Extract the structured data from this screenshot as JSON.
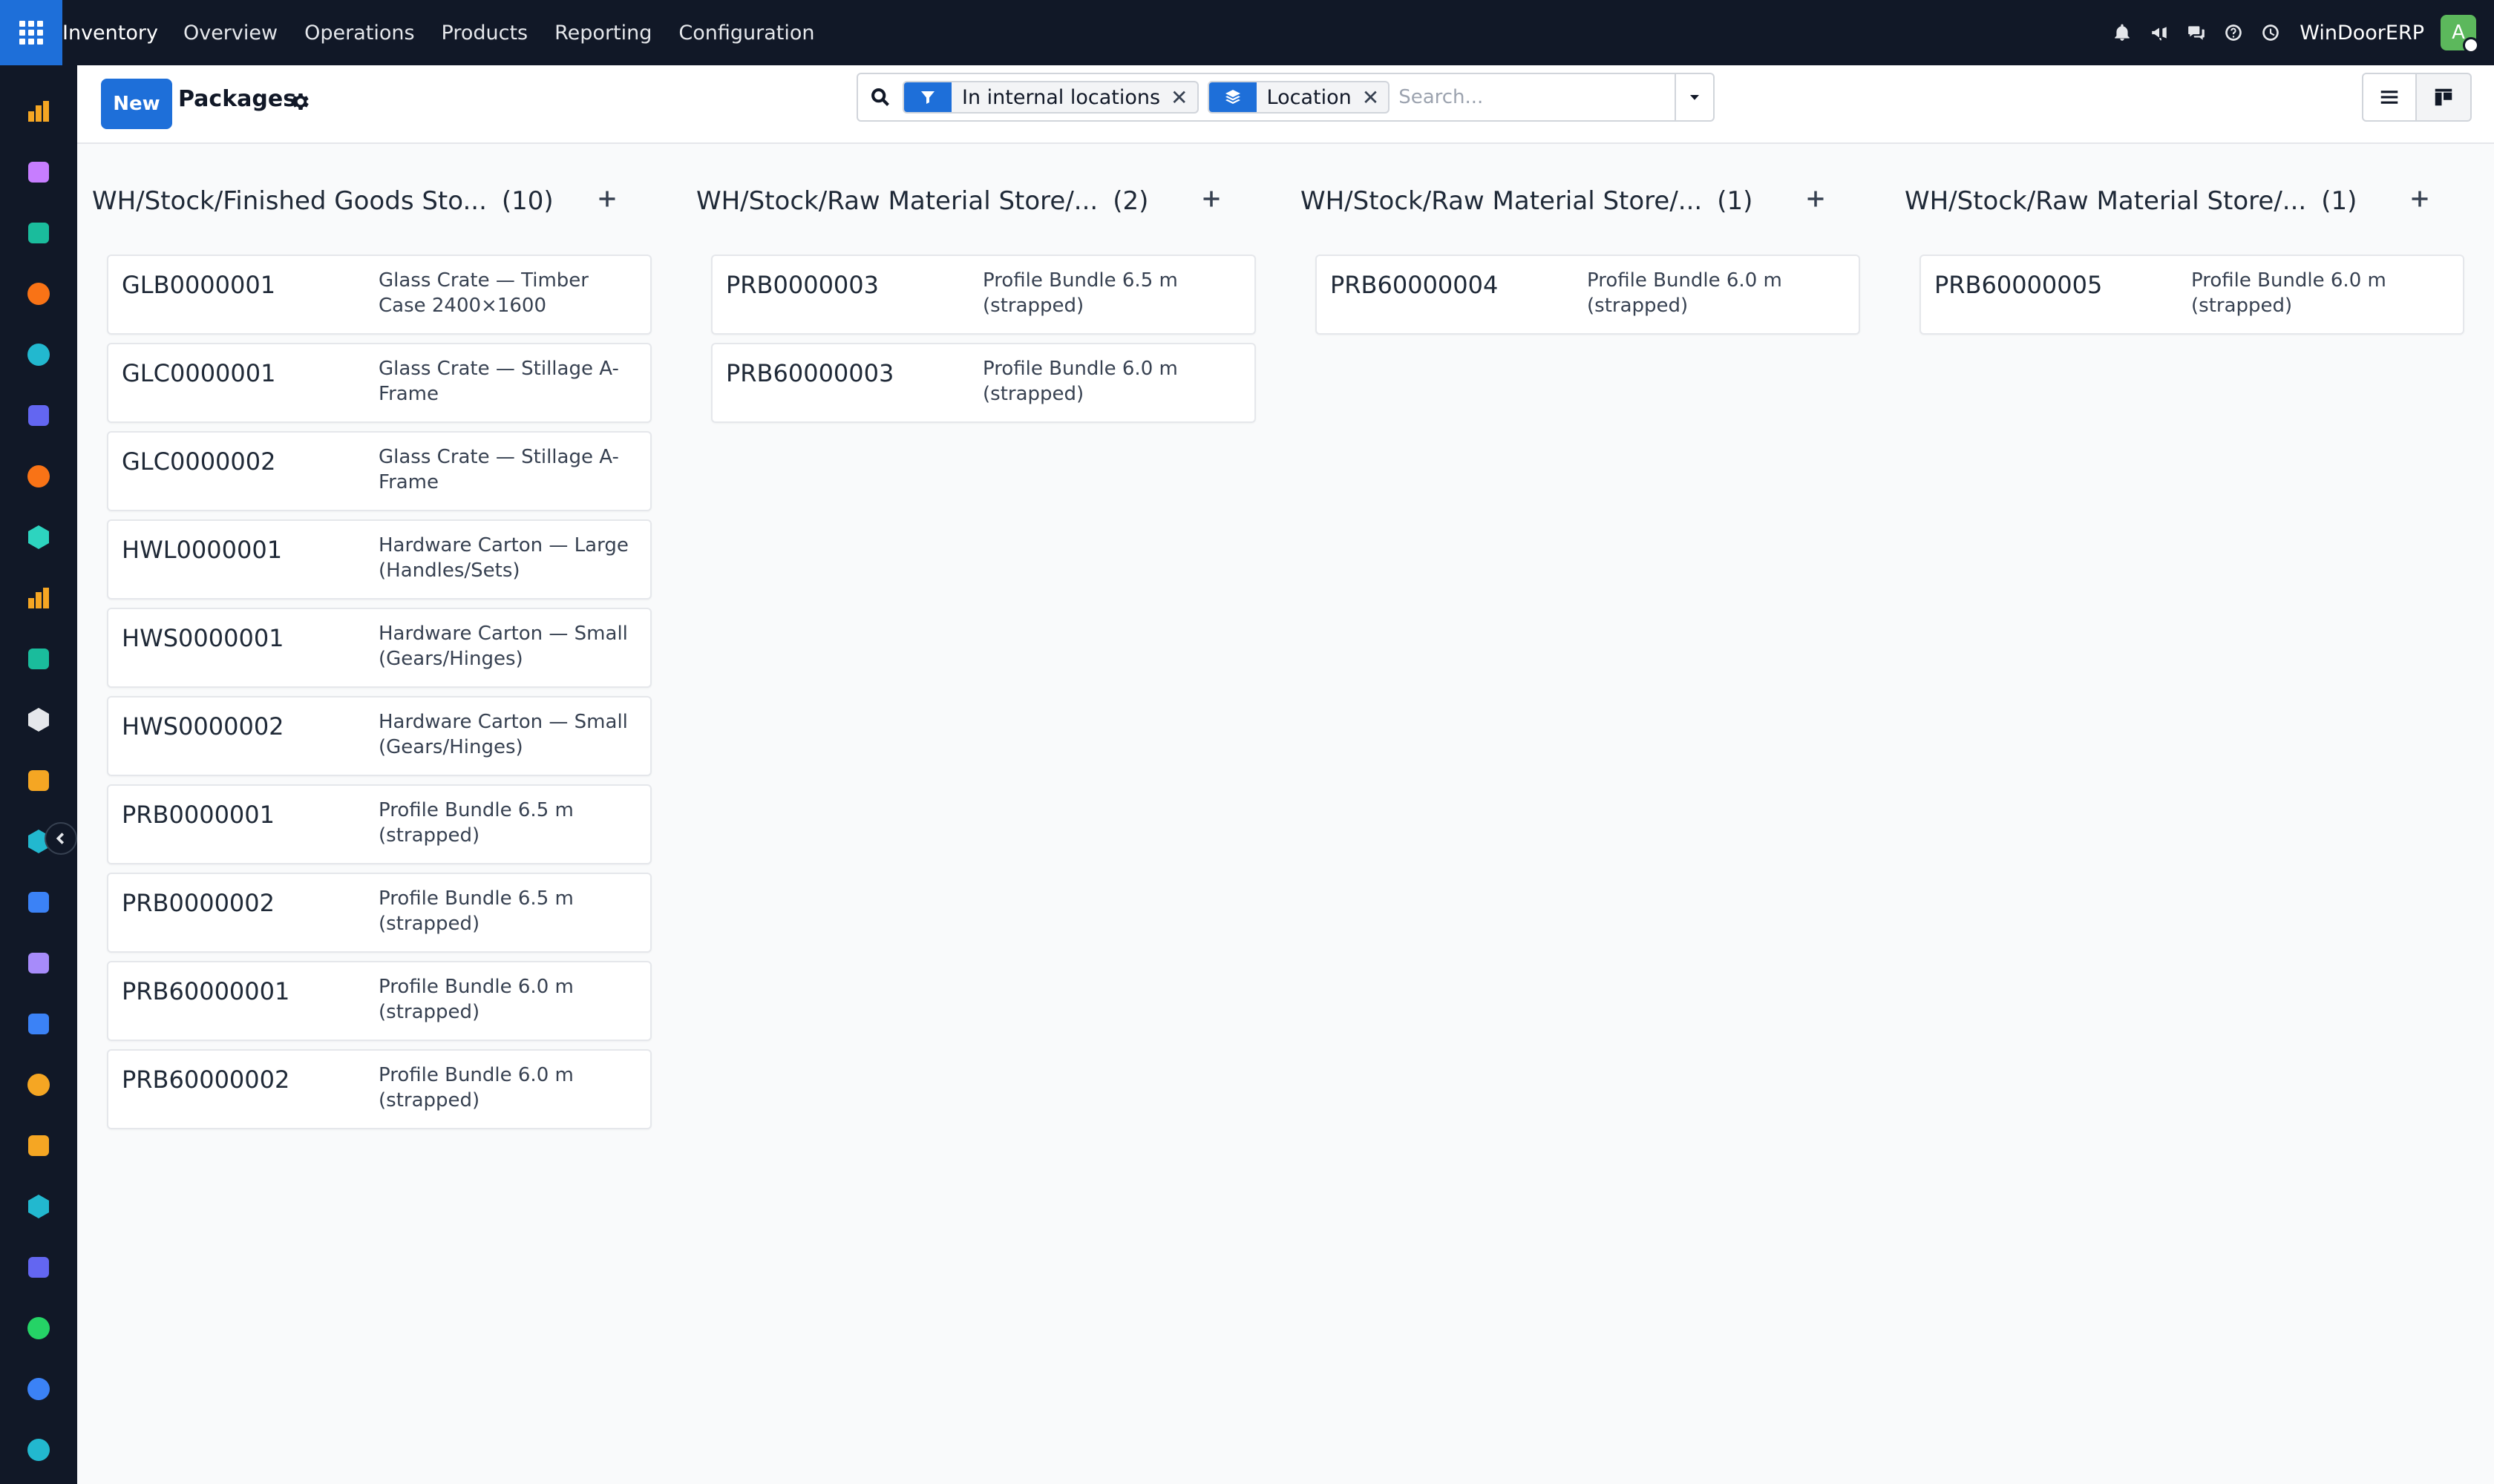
{
  "nav": {
    "brand": "Inventory",
    "menu": [
      "Overview",
      "Operations",
      "Products",
      "Reporting",
      "Configuration"
    ],
    "company": "WinDoorERP",
    "avatar_letter": "A"
  },
  "control": {
    "new_label": "New",
    "title": "Packages"
  },
  "search": {
    "facets": [
      {
        "label": "In internal locations",
        "icon": "filter-icon"
      },
      {
        "label": "Location",
        "icon": "layers-icon"
      }
    ],
    "placeholder": "Search..."
  },
  "columns": [
    {
      "title": "WH/Stock/Finished Goods Sto...",
      "count": "(10)",
      "cards": [
        {
          "name": "GLB0000001",
          "type": "Glass Crate — Timber Case 2400×1600"
        },
        {
          "name": "GLC0000001",
          "type": "Glass Crate — Stillage A-Frame"
        },
        {
          "name": "GLC0000002",
          "type": "Glass Crate — Stillage A-Frame"
        },
        {
          "name": "HWL0000001",
          "type": "Hardware Carton — Large (Handles/Sets)"
        },
        {
          "name": "HWS0000001",
          "type": "Hardware Carton — Small (Gears/Hinges)"
        },
        {
          "name": "HWS0000002",
          "type": "Hardware Carton — Small (Gears/Hinges)"
        },
        {
          "name": "PRB0000001",
          "type": "Profile Bundle 6.5 m (strapped)"
        },
        {
          "name": "PRB0000002",
          "type": "Profile Bundle 6.5 m (strapped)"
        },
        {
          "name": "PRB60000001",
          "type": "Profile Bundle 6.0 m (strapped)"
        },
        {
          "name": "PRB60000002",
          "type": "Profile Bundle 6.0 m (strapped)"
        }
      ]
    },
    {
      "title": "WH/Stock/Raw Material Store/...",
      "count": "(2)",
      "cards": [
        {
          "name": "PRB0000003",
          "type": "Profile Bundle 6.5 m (strapped)"
        },
        {
          "name": "PRB60000003",
          "type": "Profile Bundle 6.0 m (strapped)"
        }
      ]
    },
    {
      "title": "WH/Stock/Raw Material Store/...",
      "count": "(1)",
      "cards": [
        {
          "name": "PRB60000004",
          "type": "Profile Bundle 6.0 m (strapped)"
        }
      ]
    },
    {
      "title": "WH/Stock/Raw Material Store/...",
      "count": "(1)",
      "cards": [
        {
          "name": "PRB60000005",
          "type": "Profile Bundle 6.0 m (strapped)"
        }
      ]
    }
  ],
  "rail_apps": [
    {
      "icon": "dashboard-icon",
      "color": "#f5a623"
    },
    {
      "icon": "studio-icon",
      "color": "#c77dff"
    },
    {
      "icon": "contacts-icon",
      "color": "#1abc9c"
    },
    {
      "icon": "chat-icon",
      "color": "#f97316"
    },
    {
      "icon": "website-icon",
      "color": "#22b8cf"
    },
    {
      "icon": "mail-icon",
      "color": "#6366f1"
    },
    {
      "icon": "discuss-icon",
      "color": "#f97316"
    },
    {
      "icon": "crm-icon",
      "color": "#2dd4bf"
    },
    {
      "icon": "sales-icon",
      "color": "#f5a623"
    },
    {
      "icon": "employees-icon",
      "color": "#1abc9c"
    },
    {
      "icon": "inventory-icon",
      "color": "#e5e7eb"
    },
    {
      "icon": "spreadsheet-icon",
      "color": "#f5a623"
    },
    {
      "icon": "todo-icon",
      "color": "#22b8cf"
    },
    {
      "icon": "knowledge-icon",
      "color": "#3b82f6"
    },
    {
      "icon": "purchase-icon",
      "color": "#a78bfa"
    },
    {
      "icon": "invoicing-icon",
      "color": "#3b82f6"
    },
    {
      "icon": "team-icon",
      "color": "#f5a623"
    },
    {
      "icon": "calendar-icon",
      "color": "#f5a623"
    },
    {
      "icon": "sign-icon",
      "color": "#22b8cf"
    },
    {
      "icon": "apps-dashboard-icon",
      "color": "#6366f1"
    },
    {
      "icon": "whatsapp-icon",
      "color": "#25d366"
    },
    {
      "icon": "timer-icon",
      "color": "#3b82f6"
    },
    {
      "icon": "website-builder-icon",
      "color": "#22b8cf"
    }
  ]
}
